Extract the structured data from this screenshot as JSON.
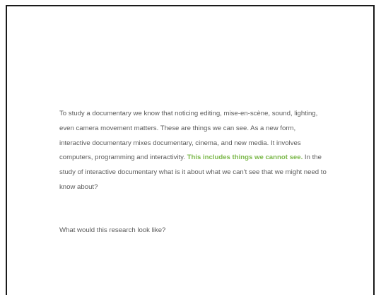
{
  "paragraph": {
    "before": "To study a documentary we know that noticing editing, mise-en-scène, sound, lighting, even camera movement matters. These are things we can see. As a new form, interactive documentary mixes documentary, cinema, and new media. It involves computers, programming and interactivity. ",
    "highlight": "This includes things we cannot see.",
    "after": " In the study of interactive documentary what is it about what we can't see that we might need to know about?"
  },
  "question": "What would this research look like?",
  "colors": {
    "text": "#5a5a5a",
    "highlight": "#7bb84a",
    "border": "#1a1a1a"
  }
}
